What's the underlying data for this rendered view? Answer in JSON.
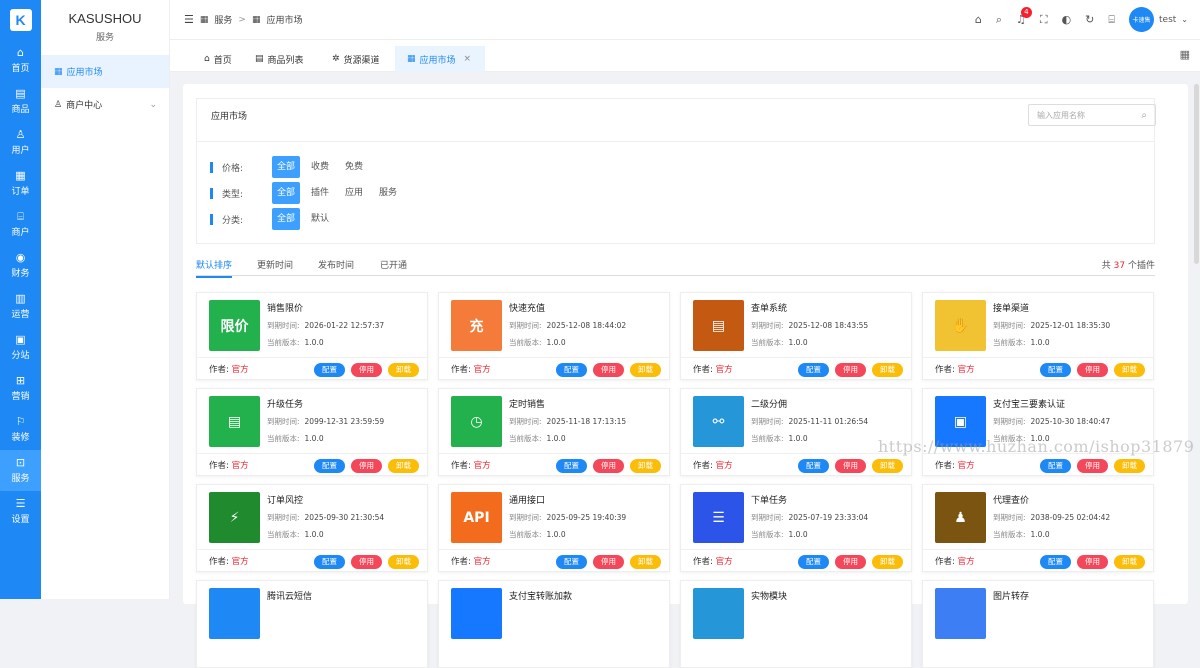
{
  "rail": {
    "logo": "K",
    "items": [
      {
        "label": "首页",
        "icon": "⌂"
      },
      {
        "label": "商品",
        "icon": "▤"
      },
      {
        "label": "用户",
        "icon": "♙"
      },
      {
        "label": "订单",
        "icon": "▦"
      },
      {
        "label": "商户",
        "icon": "⌸"
      },
      {
        "label": "财务",
        "icon": "◉"
      },
      {
        "label": "运营",
        "icon": "▥"
      },
      {
        "label": "分站",
        "icon": "▣"
      },
      {
        "label": "营销",
        "icon": "⊞"
      },
      {
        "label": "装修",
        "icon": "⚐"
      },
      {
        "label": "服务",
        "icon": "⊡"
      },
      {
        "label": "设置",
        "icon": "☰"
      }
    ],
    "active": 10
  },
  "sidebar": {
    "brand": "KASUSHOU",
    "sub": "服务",
    "items": [
      {
        "label": "应用市场",
        "icon": "▦"
      },
      {
        "label": "商户中心",
        "icon": "♙"
      }
    ]
  },
  "topbar": {
    "crumb1": "服务",
    "sep": ">",
    "crumb2": "应用市场",
    "badge": "4",
    "avatar": "卡速售",
    "user": "test"
  },
  "tabs": [
    {
      "label": "首页",
      "icon": "⌂"
    },
    {
      "label": "商品列表",
      "icon": "▤"
    },
    {
      "label": "货源渠道",
      "icon": "✲"
    },
    {
      "label": "应用市场",
      "icon": "▦",
      "close": "×"
    }
  ],
  "filter": {
    "title": "应用市场",
    "search_placeholder": "输入应用名称",
    "rows": [
      {
        "label": "价格:",
        "options": [
          "全部",
          "收费",
          "免费"
        ]
      },
      {
        "label": "类型:",
        "options": [
          "全部",
          "插件",
          "应用",
          "服务"
        ]
      },
      {
        "label": "分类:",
        "options": [
          "全部",
          "默认"
        ]
      }
    ]
  },
  "sort": {
    "items": [
      "默认排序",
      "更新时间",
      "发布时间",
      "已开通"
    ],
    "total_prefix": "共",
    "total": "37",
    "total_suffix": "个插件"
  },
  "labels": {
    "expire": "到期时间:",
    "version": "当前版本:",
    "author": "作者:",
    "btn_config": "配置",
    "btn_stop": "停用",
    "btn_uninstall": "卸载"
  },
  "cards": [
    {
      "name": "销售限价",
      "expire": "2026-01-22 12:57:37",
      "version": "1.0.0",
      "author": "官方",
      "color": "#22b14c",
      "glyph": "限价"
    },
    {
      "name": "快速充值",
      "expire": "2025-12-08 18:44:02",
      "version": "1.0.0",
      "author": "官方",
      "color": "#f47b3a",
      "glyph": "充"
    },
    {
      "name": "查单系统",
      "expire": "2025-12-08 18:43:55",
      "version": "1.0.0",
      "author": "官方",
      "color": "#c45a12",
      "glyph": "▤"
    },
    {
      "name": "接单渠道",
      "expire": "2025-12-01 18:35:30",
      "version": "1.0.0",
      "author": "官方",
      "color": "#f1c232",
      "glyph": "✋"
    },
    {
      "name": "升级任务",
      "expire": "2099-12-31 23:59:59",
      "version": "1.0.0",
      "author": "官方",
      "color": "#22b14c",
      "glyph": "▤"
    },
    {
      "name": "定时销售",
      "expire": "2025-11-18 17:13:15",
      "version": "1.0.0",
      "author": "官方",
      "color": "#22b14c",
      "glyph": "◷"
    },
    {
      "name": "二级分佣",
      "expire": "2025-11-11 01:26:54",
      "version": "1.0.0",
      "author": "官方",
      "color": "#2596d8",
      "glyph": "⚯"
    },
    {
      "name": "支付宝三要素认证",
      "expire": "2025-10-30 18:40:47",
      "version": "1.0.0",
      "author": "官方",
      "color": "#1677ff",
      "glyph": "▣"
    },
    {
      "name": "订单风控",
      "expire": "2025-09-30 21:30:54",
      "version": "1.0.0",
      "author": "官方",
      "color": "#1f8a2e",
      "glyph": "⚡"
    },
    {
      "name": "通用接口",
      "expire": "2025-09-25 19:40:39",
      "version": "1.0.0",
      "author": "官方",
      "color": "#f36b1c",
      "glyph": "API"
    },
    {
      "name": "下单任务",
      "expire": "2025-07-19 23:33:04",
      "version": "1.0.0",
      "author": "官方",
      "color": "#2c54e8",
      "glyph": "☰"
    },
    {
      "name": "代理查价",
      "expire": "2038-09-25 02:04:42",
      "version": "1.0.0",
      "author": "官方",
      "color": "#7a5410",
      "glyph": "♟"
    },
    {
      "name": "腾讯云短信",
      "color": "#1e88f5"
    },
    {
      "name": "支付宝转账加款",
      "color": "#1677ff"
    },
    {
      "name": "实物模块",
      "color": "#2596d8"
    },
    {
      "name": "图片转存",
      "color": "#3d7ef5"
    }
  ],
  "watermark": "https://www.huzhan.com/ishop31879"
}
